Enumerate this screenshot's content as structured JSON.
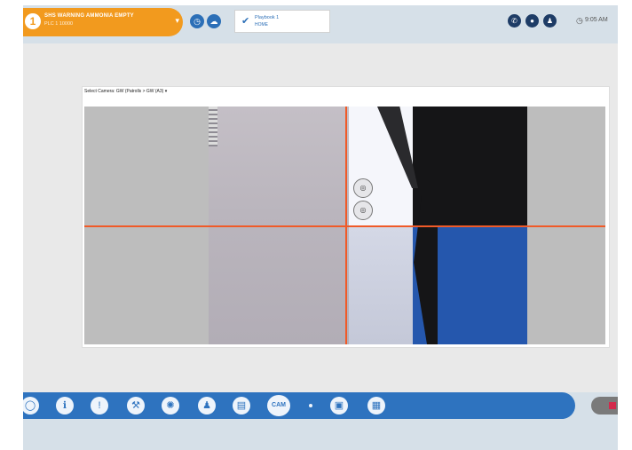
{
  "header": {
    "alarm": {
      "badge": "1",
      "title": "SHS WARNING AMMONIA EMPTY",
      "subtitle": "PLC 1 10000"
    },
    "status": {
      "check_icon": "checkmark-icon",
      "line1": "Playbook 1",
      "line2": "HOME"
    },
    "clock": {
      "icon": "clock-icon",
      "time": "9:05 AM"
    }
  },
  "panel": {
    "camera_select": "Select Camera: GW (Patrolls > GW (A3) ▾"
  },
  "toolbar": {
    "cam_label": "CAM"
  },
  "colors": {
    "alarm_orange": "#f29a1e",
    "toolbar_blue": "#2e73bf",
    "crosshair_orange": "#f05a28",
    "dark_navy": "#1e3c66"
  }
}
